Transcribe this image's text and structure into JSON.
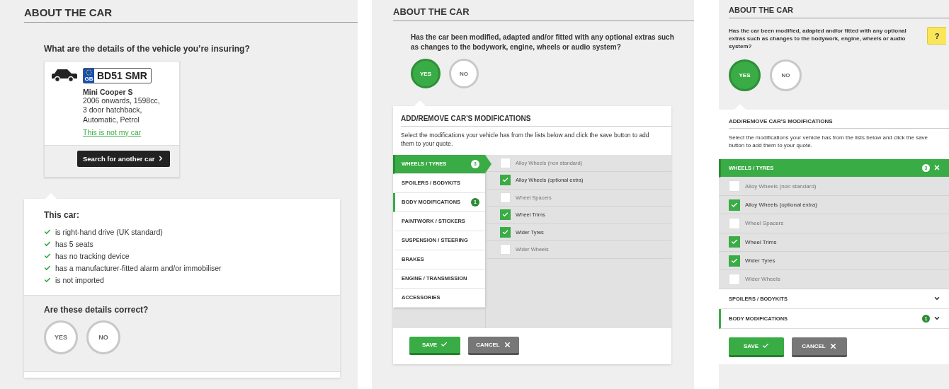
{
  "vehicle_panel": {
    "heading": "ABOUT THE CAR",
    "question": "What are the details of the vehicle you’re insuring?",
    "car": {
      "plate_country": "GB",
      "plate": "BD51 SMR",
      "model": "Mini Cooper S",
      "details": [
        "2006 onwards, 1598cc,",
        "3 door hatchback,",
        "Automatic, Petrol"
      ],
      "link": "This is not my car",
      "button": "Search for another car"
    },
    "features_title": "This car:",
    "features": [
      "is right-hand drive (UK standard)",
      "has 5 seats",
      "has no tracking device",
      "has a manufacturer-fitted alarm and/or immobiliser",
      "is not imported"
    ],
    "confirm": {
      "question": "Are these details correct?",
      "options": [
        {
          "label": "YES",
          "selected": false
        },
        {
          "label": "NO",
          "selected": false
        }
      ]
    }
  },
  "desktop_panel": {
    "heading": "ABOUT THE CAR",
    "question": "Has the car been modified, adapted and/or fitted with any optional extras such as changes to the bodywork, engine, wheels or audio system?",
    "options": [
      {
        "label": "YES",
        "selected": true
      },
      {
        "label": "NO",
        "selected": false
      }
    ],
    "modifications": {
      "title": "ADD/REMOVE CAR'S MODIFICATIONS",
      "intro": "Select the modifications your vehicle has from the lists below and click the save button to add them to your quote.",
      "categories": [
        {
          "label": "WHEELS / TYRES",
          "selected": true,
          "count": "3"
        },
        {
          "label": "SPOILERS / BODYKITS",
          "selected": false
        },
        {
          "label": "BODY MODIFICATIONS",
          "selected": false,
          "count": "1"
        },
        {
          "label": "PAINTWORK / STICKERS",
          "selected": false
        },
        {
          "label": "SUSPENSION / STEERING",
          "selected": false
        },
        {
          "label": "BRAKES",
          "selected": false
        },
        {
          "label": "ENGINE / TRANSMISSION",
          "selected": false
        },
        {
          "label": "ACCESSORIES",
          "selected": false
        }
      ],
      "items": [
        {
          "label": "Alloy Wheels (non standard)",
          "checked": false
        },
        {
          "label": "Alloy Wheels (optional extra)",
          "checked": true
        },
        {
          "label": "Wheel Spacers",
          "checked": false
        },
        {
          "label": "Wheel Trims",
          "checked": true
        },
        {
          "label": "Wider Tyres",
          "checked": true
        },
        {
          "label": "Wider Wheels",
          "checked": false
        }
      ],
      "buttons": [
        {
          "kind": "save",
          "label": "SAVE"
        },
        {
          "kind": "cancel",
          "label": "CANCEL"
        }
      ]
    }
  },
  "mobile_panel": {
    "heading": "ABOUT THE CAR",
    "help": "?",
    "question": "Has the car been modified, adapted and/or fitted with any optional extras such as changes to the bodywork, engine, wheels or audio system?",
    "options": [
      {
        "label": "YES",
        "selected": true
      },
      {
        "label": "NO",
        "selected": false
      }
    ],
    "modifications": {
      "title": "ADD/REMOVE CAR'S MODIFICATIONS",
      "intro": "Select the modifications your vehicle has from the lists below and click the save button to add them to your quote.",
      "sections": [
        {
          "label": "WHEELS / TYRES",
          "expanded": true,
          "count": "3",
          "items": [
            {
              "label": "Alloy Wheels (non standard)",
              "checked": false
            },
            {
              "label": "Alloy Wheels (optional extra)",
              "checked": true
            },
            {
              "label": "Wheel Spacers",
              "checked": false
            },
            {
              "label": "Wheel Trims",
              "checked": true
            },
            {
              "label": "Wider Tyres",
              "checked": true
            },
            {
              "label": "Wider Wheels",
              "checked": false
            }
          ]
        },
        {
          "label": "SPOILERS / BODYKITS",
          "expanded": false
        },
        {
          "label": "BODY MODIFICATIONS",
          "expanded": false,
          "count": "1"
        }
      ],
      "buttons": [
        {
          "kind": "save",
          "label": "SAVE"
        },
        {
          "kind": "cancel",
          "label": "CANCEL"
        }
      ]
    }
  }
}
